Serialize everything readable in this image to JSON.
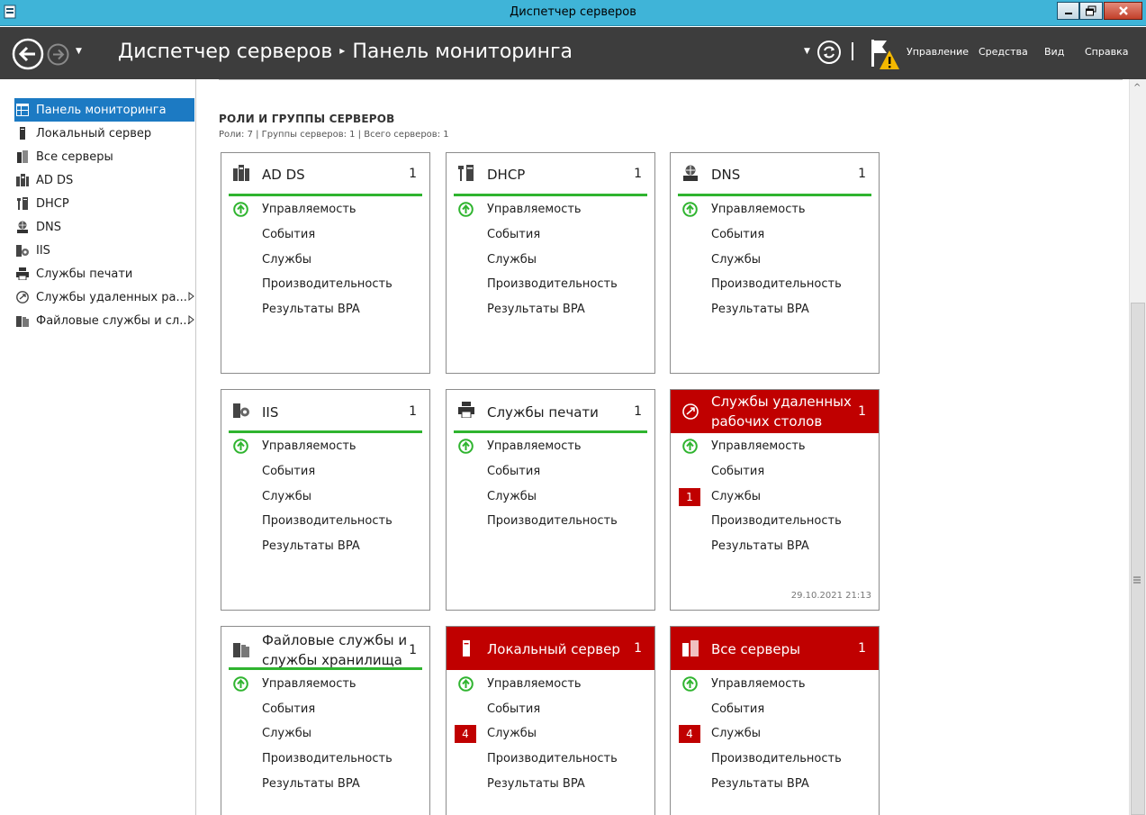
{
  "window": {
    "title": "Диспетчер серверов"
  },
  "header": {
    "app": "Диспетчер серверов",
    "separator": "▸",
    "page": "Панель мониторинга",
    "menu": [
      "Управление",
      "Средства",
      "Вид",
      "Справка"
    ]
  },
  "sidebar": {
    "items": [
      {
        "label": "Панель мониторинга",
        "icon": "dashboard-icon",
        "active": true
      },
      {
        "label": "Локальный сервер",
        "icon": "local-server-icon"
      },
      {
        "label": "Все серверы",
        "icon": "all-servers-icon"
      },
      {
        "label": "AD DS",
        "icon": "adds-icon"
      },
      {
        "label": "DHCP",
        "icon": "dhcp-icon"
      },
      {
        "label": "DNS",
        "icon": "dns-icon"
      },
      {
        "label": "IIS",
        "icon": "iis-icon"
      },
      {
        "label": "Службы печати",
        "icon": "printer-icon"
      },
      {
        "label": "Службы удаленных ра...",
        "icon": "remote-desktop-icon",
        "expandable": true
      },
      {
        "label": "Файловые службы и сл...",
        "icon": "file-services-icon",
        "expandable": true
      }
    ]
  },
  "section": {
    "title": "РОЛИ И ГРУППЫ СЕРВЕРОВ",
    "subtitle": "Роли: 7 | Группы серверов: 1 | Всего серверов: 1"
  },
  "cards": [
    {
      "title": "AD DS",
      "count": "1",
      "status": "ok",
      "rows": [
        "Управляемость",
        "События",
        "Службы",
        "Производительность",
        "Результаты BPA"
      ]
    },
    {
      "title": "DHCP",
      "count": "1",
      "status": "ok",
      "rows": [
        "Управляемость",
        "События",
        "Службы",
        "Производительность",
        "Результаты BPA"
      ]
    },
    {
      "title": "DNS",
      "count": "1",
      "status": "ok",
      "rows": [
        "Управляемость",
        "События",
        "Службы",
        "Производительность",
        "Результаты BPA"
      ]
    },
    {
      "title": "IIS",
      "count": "1",
      "status": "ok",
      "rows": [
        "Управляемость",
        "События",
        "Службы",
        "Производительность",
        "Результаты BPA"
      ]
    },
    {
      "title": "Службы печати",
      "count": "1",
      "status": "ok",
      "rows": [
        "Управляемость",
        "События",
        "Службы",
        "Производительность"
      ]
    },
    {
      "title_lines": [
        "Службы удаленных",
        "рабочих столов"
      ],
      "count": "1",
      "status": "alert",
      "rows": [
        "Управляемость",
        "События",
        "Службы",
        "Производительность",
        "Результаты BPA"
      ],
      "services_badge": "1",
      "timestamp": "29.10.2021 21:13"
    },
    {
      "title_lines": [
        "Файловые службы и",
        "службы хранилища"
      ],
      "count": "1",
      "status": "ok",
      "rows": [
        "Управляемость",
        "События",
        "Службы",
        "Производительность",
        "Результаты BPA"
      ]
    },
    {
      "title": "Локальный сервер",
      "count": "1",
      "status": "alert",
      "rows": [
        "Управляемость",
        "События",
        "Службы",
        "Производительность",
        "Результаты BPA"
      ],
      "services_badge": "4"
    },
    {
      "title": "Все серверы",
      "count": "1",
      "status": "alert",
      "rows": [
        "Управляемость",
        "События",
        "Службы",
        "Производительность",
        "Результаты BPA"
      ],
      "services_badge": "4"
    }
  ],
  "colors": {
    "header": "#3d3d3d",
    "titlebar": "#3fb4d8",
    "accent": "#1c7ac3",
    "alert": "#c00000",
    "ok": "#2fb42f"
  }
}
